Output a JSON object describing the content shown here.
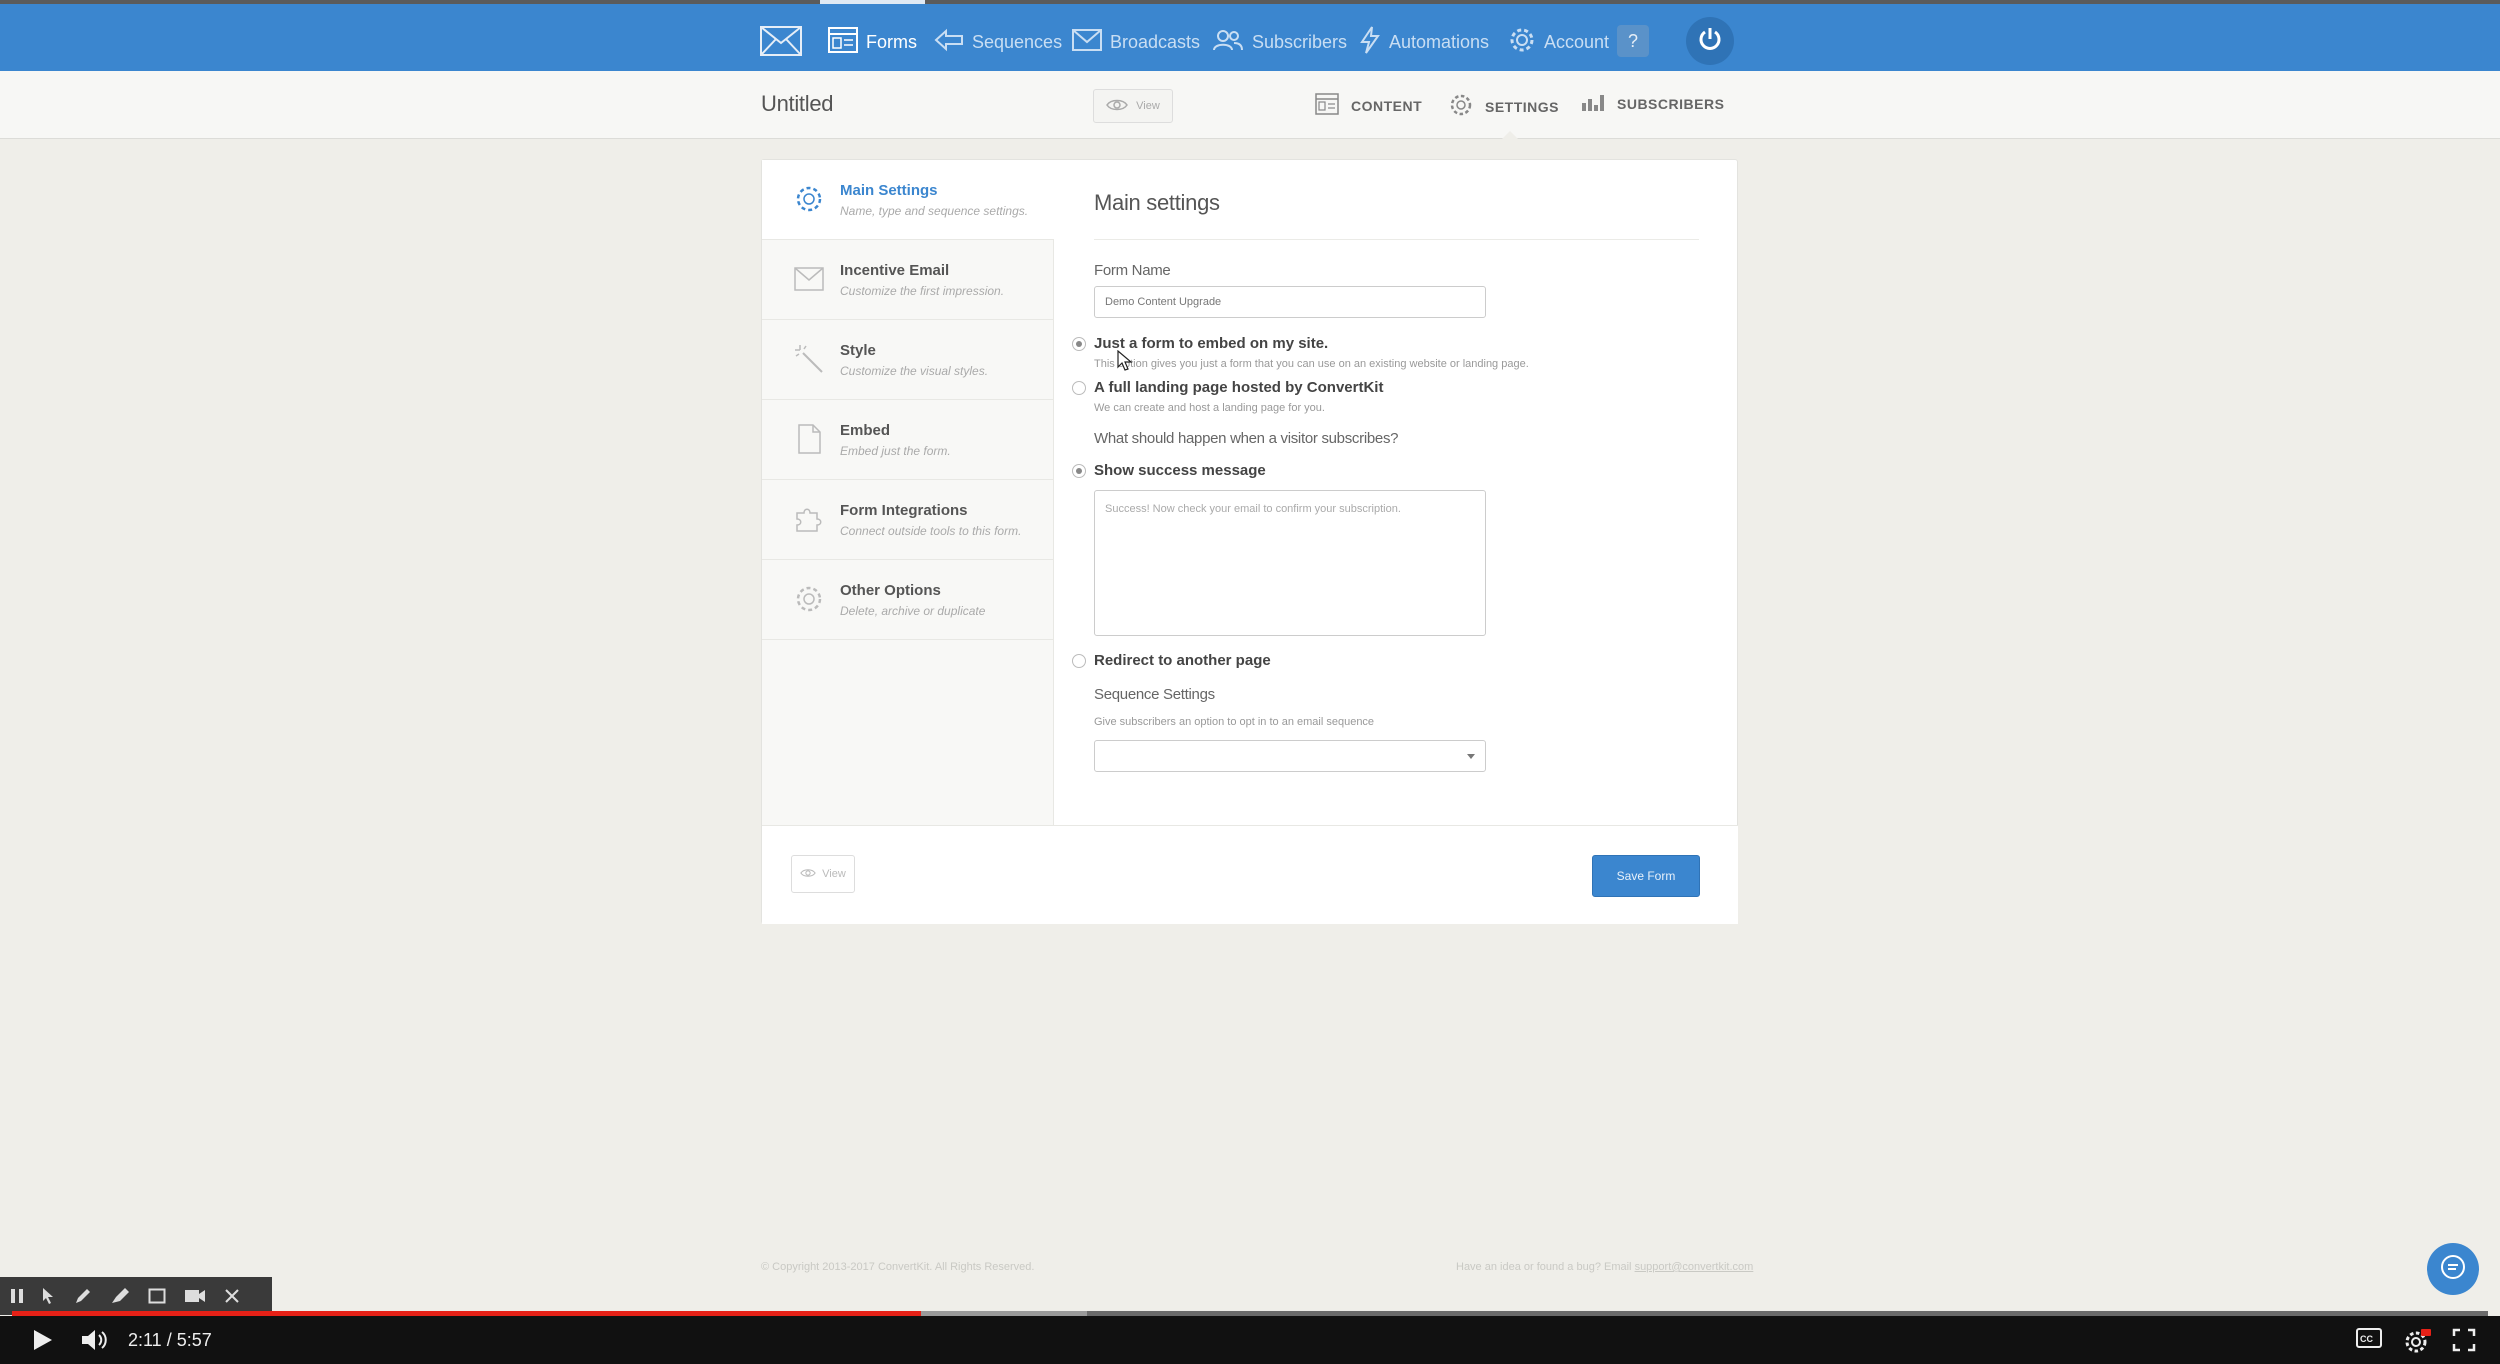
{
  "nav": {
    "items": [
      {
        "label": "Forms",
        "icon": "forms-icon",
        "active": true
      },
      {
        "label": "Sequences",
        "icon": "sequences-icon"
      },
      {
        "label": "Broadcasts",
        "icon": "broadcasts-icon"
      },
      {
        "label": "Subscribers",
        "icon": "subscribers-icon"
      },
      {
        "label": "Automations",
        "icon": "automations-icon"
      },
      {
        "label": "Account",
        "icon": "account-gear-icon"
      }
    ],
    "help_label": "?"
  },
  "subheader": {
    "title": "Untitled",
    "view_label": "View",
    "tabs": [
      {
        "label": "CONTENT",
        "icon": "content-icon"
      },
      {
        "label": "SETTINGS",
        "icon": "settings-gear-icon",
        "active": true
      },
      {
        "label": "SUBSCRIBERS",
        "icon": "bar-chart-icon"
      }
    ]
  },
  "sidebar": {
    "items": [
      {
        "label": "Main Settings",
        "desc": "Name, type and sequence settings.",
        "icon": "gear-icon",
        "active": true
      },
      {
        "label": "Incentive Email",
        "desc": "Customize the first impression.",
        "icon": "envelope-icon"
      },
      {
        "label": "Style",
        "desc": "Customize the visual styles.",
        "icon": "magic-wand-icon"
      },
      {
        "label": "Embed",
        "desc": "Embed just the form.",
        "icon": "document-icon"
      },
      {
        "label": "Form Integrations",
        "desc": "Connect outside tools to this form.",
        "icon": "puzzle-icon"
      },
      {
        "label": "Other Options",
        "desc": "Delete, archive or duplicate",
        "icon": "gear-icon"
      }
    ]
  },
  "main": {
    "title": "Main settings",
    "form_name_label": "Form Name",
    "form_name_value": "Demo Content Upgrade",
    "type_options": [
      {
        "label": "Just a form to embed on my site.",
        "help": "This option gives you just a form that you can use on an existing website or landing page.",
        "checked": true
      },
      {
        "label": "A full landing page hosted by ConvertKit",
        "help": "We can create and host a landing page for you.",
        "checked": false
      }
    ],
    "subscribe_question": "What should happen when a visitor subscribes?",
    "success_option": {
      "label": "Show success message",
      "checked": true
    },
    "success_message": "Success! Now check your email to confirm your subscription.",
    "redirect_option": {
      "label": "Redirect to another page",
      "checked": false
    },
    "sequence_label": "Sequence Settings",
    "sequence_help": "Give subscribers an option to opt in to an email sequence",
    "sequence_value": ""
  },
  "footer_buttons": {
    "view_label": "View",
    "save_label": "Save Form"
  },
  "page_footer": {
    "copyright": "© Copyright 2013-2017 ConvertKit. All Rights Reserved.",
    "bug_text": "Have an idea or found a bug? Email ",
    "bug_email": "support@convertkit.com"
  },
  "player": {
    "time": "2:11 / 5:57",
    "progress": 0.367,
    "buffered": 0.434
  },
  "colors": {
    "brand": "#3b86cf",
    "background": "#efeee9",
    "progress": "#e62117"
  }
}
